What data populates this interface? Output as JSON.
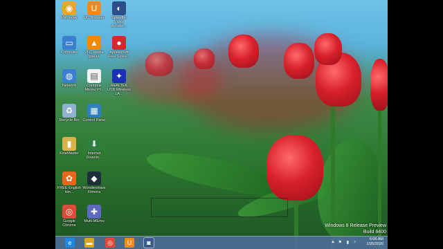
{
  "desktop_icons": [
    {
      "label": "KMPlayer",
      "icon": "kmplayer-icon",
      "color": "#e8a72a"
    },
    {
      "label": "UC Browser",
      "icon": "uc-browser-icon",
      "color": "#f08a1e"
    },
    {
      "label": "Speedbit Video Acceler...",
      "icon": "speedbit-icon",
      "color": "#2d4f8a"
    },
    {
      "label": "Computer",
      "icon": "computer-icon",
      "color": "#3b7fd1"
    },
    {
      "label": "VLC media player",
      "icon": "vlc-icon",
      "color": "#f18a00"
    },
    {
      "label": "Apowersoft Free Scree...",
      "icon": "apowersoft-icon",
      "color": "#d7282f"
    },
    {
      "label": "Network",
      "icon": "network-icon",
      "color": "#3c7ed1"
    },
    {
      "label": "Continue MEmu Pl...",
      "icon": "document-icon",
      "color": "#f2f2f2"
    },
    {
      "label": "REALTEK USB Wireless LA...",
      "icon": "realtek-icon",
      "color": "#1b2fb8"
    },
    {
      "label": "Recycle Bin",
      "icon": "recycle-bin-icon",
      "color": "#8fb3cf"
    },
    {
      "label": "Control Panel",
      "icon": "control-panel-icon",
      "color": "#2f7fc1"
    },
    {
      "label": "KineMaster",
      "icon": "folder-icon",
      "color": "#d8b24a"
    },
    {
      "label": "Internet Downlo...",
      "icon": "idm-icon",
      "color": "#2e7f3c"
    },
    {
      "label": "FREE English Hin...",
      "icon": "free-english-icon",
      "color": "#e8661c"
    },
    {
      "label": "Wondershare Filmora",
      "icon": "filmora-icon",
      "color": "#1e2f3a"
    },
    {
      "label": "Google Chrome",
      "icon": "chrome-icon",
      "color": "#dd4b39"
    },
    {
      "label": "Multi-MEmu",
      "icon": "multi-memu-icon",
      "color": "#5c6bc0"
    }
  ],
  "taskbar": {
    "apps": [
      {
        "icon": "internet-explorer-icon"
      },
      {
        "icon": "file-explorer-icon"
      },
      {
        "icon": "chrome-icon"
      },
      {
        "icon": "uc-browser-icon"
      },
      {
        "icon": "screen-recorder-icon"
      }
    ],
    "clock_time": "6:06 AM",
    "clock_date": "1/25/2020"
  },
  "watermark": {
    "line1": "Windows 8 Release Preview",
    "line2": "Build 8400"
  }
}
